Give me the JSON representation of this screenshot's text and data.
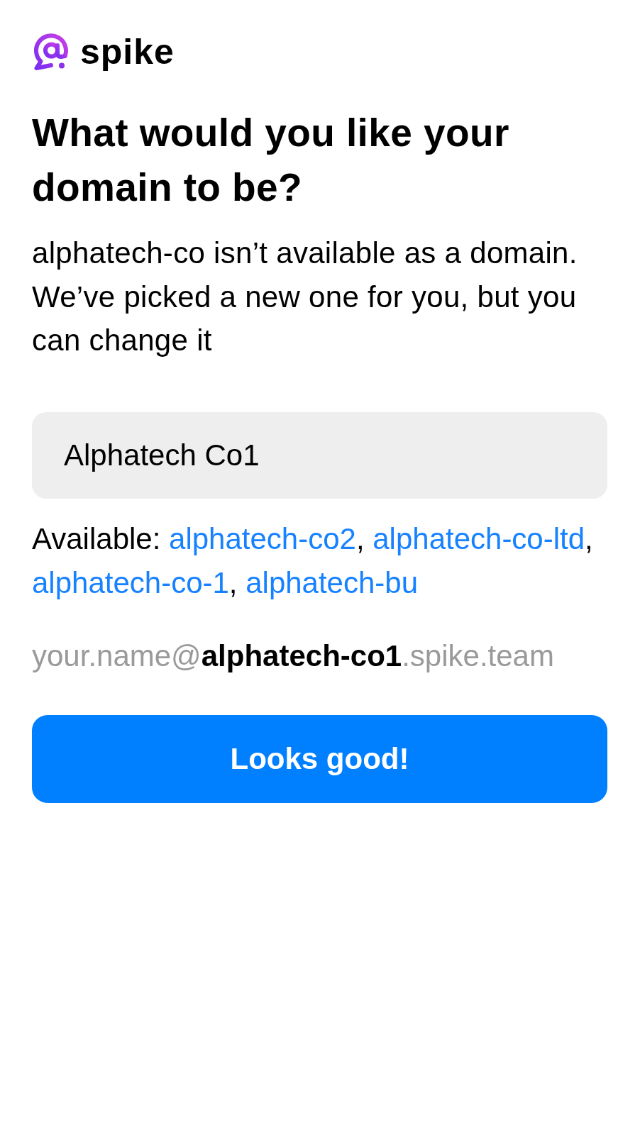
{
  "logo": {
    "name": "spike"
  },
  "heading": "What would you like your domain to be?",
  "message": "alphatech-co isn’t available as a domain. We’ve picked a new one for you, but you can change it",
  "domain_field": {
    "value": "Alphatech Co1"
  },
  "suggestions": {
    "label": "Available:",
    "separator": ",",
    "items": [
      "alphatech-co2",
      "alphatech-co-ltd",
      "alphatech-co-1",
      "alphatech-bu"
    ]
  },
  "email_preview": "your.name@**alphatech-co1**.spike.team",
  "button": {
    "label": "Looks good!"
  }
}
